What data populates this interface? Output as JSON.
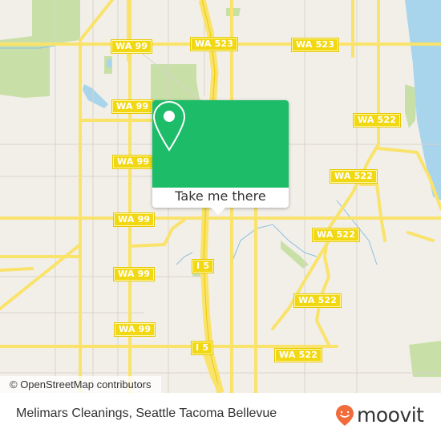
{
  "map": {
    "attribution": "© OpenStreetMap contributors",
    "colors": {
      "land": "#f2efe9",
      "road_major": "#f9e36b",
      "road_minor": "#d9d4cc",
      "park": "#c8e0a8",
      "water": "#a8d4ec",
      "shield_bg": "#f2d813",
      "popup_green": "#1dbc68"
    },
    "road_labels": [
      {
        "id": "wa99-1",
        "text": "WA 99"
      },
      {
        "id": "wa523-1",
        "text": "WA 523"
      },
      {
        "id": "wa523-2",
        "text": "WA 523"
      },
      {
        "id": "wa99-2",
        "text": "WA 99"
      },
      {
        "id": "wa522-1",
        "text": "WA 522"
      },
      {
        "id": "wa99-3",
        "text": "WA 99"
      },
      {
        "id": "wa522-2",
        "text": "WA 522"
      },
      {
        "id": "wa99-4",
        "text": "WA 99"
      },
      {
        "id": "wa522-3",
        "text": "WA 522"
      },
      {
        "id": "i5-1",
        "text": "I 5"
      },
      {
        "id": "wa99-5",
        "text": "WA 99"
      },
      {
        "id": "wa522-4",
        "text": "WA 522"
      },
      {
        "id": "wa99-6",
        "text": "WA 99"
      },
      {
        "id": "i5-2",
        "text": "I 5"
      },
      {
        "id": "wa522-5",
        "text": "WA 522"
      }
    ]
  },
  "popup": {
    "icon": "map-pin-icon",
    "button_label": "Take me there"
  },
  "footer": {
    "place_title": "Melimars Cleanings, Seattle Tacoma Bellevue",
    "brand": "moovit",
    "brand_color": "#f26b3a"
  }
}
